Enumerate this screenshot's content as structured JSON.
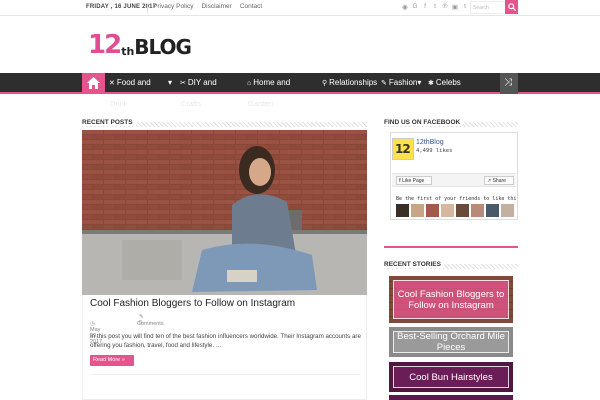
{
  "topbar": {
    "date": "FRIDAY , 16 JUNE 2017",
    "links": [
      "Privacy Policy",
      "Disclaimer",
      "Contact"
    ],
    "social_icons": [
      "rss-icon",
      "google-plus-icon",
      "facebook-icon",
      "twitter-icon",
      "pinterest-icon",
      "instagram-icon",
      "tumblr-icon"
    ],
    "search_placeholder": "Search"
  },
  "logo": {
    "num": "12",
    "th": "th",
    "blog": "BLOG"
  },
  "nav": {
    "items": [
      {
        "label": "Food and",
        "label2": "Drink",
        "icon": "cutlery-icon"
      },
      {
        "label": "DIY and",
        "label2": "Crafts",
        "icon": "scissors-icon"
      },
      {
        "label": "Home and",
        "label2": "Garden",
        "icon": "home-icon"
      },
      {
        "label": "Relationships",
        "icon": "relationship-icon"
      },
      {
        "label": "Fashion",
        "icon": "fashion-icon"
      },
      {
        "label": "Celebs",
        "icon": "star-icon"
      }
    ]
  },
  "main": {
    "section_title": "RECENT POSTS",
    "post": {
      "title": "Cool Fashion Bloggers to Follow on Instagram",
      "comment_count": "0",
      "comments_label": "Comments",
      "date": "May 29, 2017",
      "excerpt": "In this post you will find ten of the best fashion influencers worldwide. Their Instagram accounts are offering you fashion, travel, food and lifestyle. …",
      "read_more": "Read More »"
    }
  },
  "sidebar": {
    "facebook_title": "FIND US ON FACEBOOK",
    "fb_page_name": "12thBlog",
    "fb_likes": "4,499 likes",
    "fb_like_label": "Like Page",
    "fb_share_label": "Share",
    "fb_friends_text": "Be the first of your friends to like this",
    "recent_title": "RECENT STORIES",
    "stories": [
      "Cool Fashion Bloggers to Follow on Instagram",
      "Best-Selling Orchard Mile Pieces",
      "Cool Bun Hairstyles"
    ]
  },
  "colors": {
    "accent": "#e5548d",
    "nav_bg": "#2e2e2e"
  }
}
